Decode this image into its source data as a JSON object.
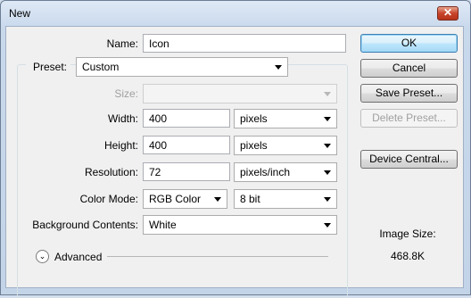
{
  "window": {
    "title": "New"
  },
  "form": {
    "name_label": "Name:",
    "name_value": "Icon",
    "preset_label": "Preset:",
    "preset_value": "Custom",
    "size_label": "Size:",
    "size_value": "",
    "width_label": "Width:",
    "width_value": "400",
    "width_unit": "pixels",
    "height_label": "Height:",
    "height_value": "400",
    "height_unit": "pixels",
    "resolution_label": "Resolution:",
    "resolution_value": "72",
    "resolution_unit": "pixels/inch",
    "color_mode_label": "Color Mode:",
    "color_mode_value": "RGB Color",
    "bit_depth_value": "8 bit",
    "background_label": "Background Contents:",
    "background_value": "White",
    "advanced_label": "Advanced"
  },
  "buttons": {
    "ok": "OK",
    "cancel": "Cancel",
    "save_preset": "Save Preset...",
    "delete_preset": "Delete Preset...",
    "device_central": "Device Central..."
  },
  "image_size": {
    "label": "Image Size:",
    "value": "468.8K"
  },
  "colors": {
    "title_bg": "#c9d9ec",
    "close_red": "#c8432a",
    "default_border": "#3c7fb1"
  }
}
